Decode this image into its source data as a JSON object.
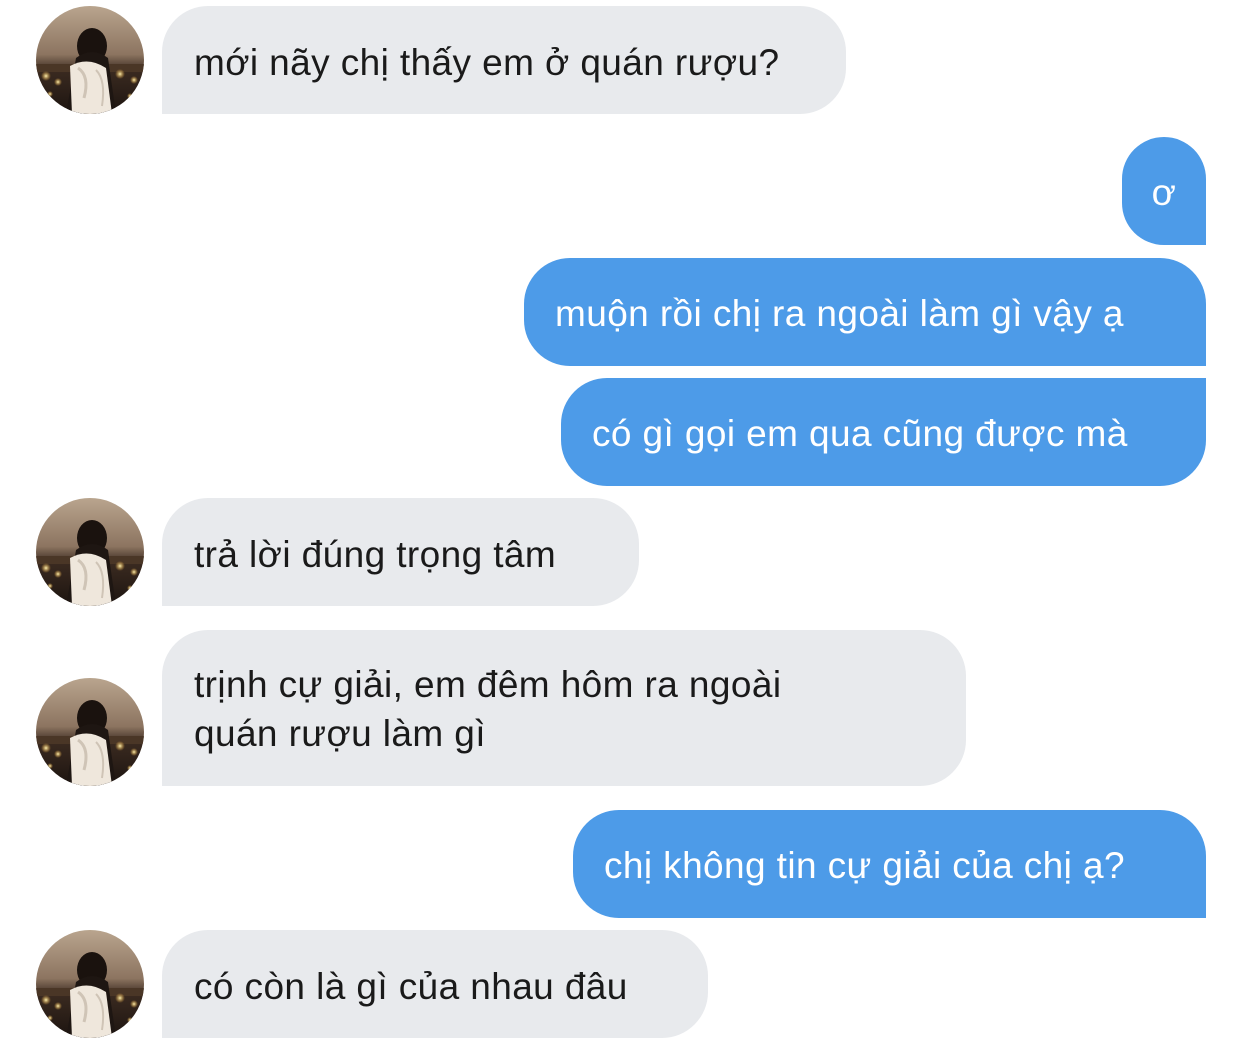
{
  "conversation": {
    "messages": [
      {
        "sender": "them",
        "text": "mới nãy chị thấy em ở quán rượu?"
      },
      {
        "sender": "me",
        "text": "ơ"
      },
      {
        "sender": "me",
        "text": "muộn rồi chị ra ngoài làm gì vậy ạ"
      },
      {
        "sender": "me",
        "text": "có gì gọi em qua cũng được mà"
      },
      {
        "sender": "them",
        "text": "trả lời đúng trọng tâm"
      },
      {
        "sender": "them",
        "lines": [
          "trịnh cự giải, em đêm hôm ra ngoài",
          "quán rượu làm gì"
        ]
      },
      {
        "sender": "me",
        "text": "chị không tin cự giải của chị ạ?"
      },
      {
        "sender": "them",
        "text": "có còn là gì của nhau đâu"
      }
    ]
  },
  "colors": {
    "incoming_bubble": "#e8eaed",
    "outgoing_bubble": "#4d9be8",
    "incoming_text": "#1a1a1a",
    "outgoing_text": "#ffffff"
  },
  "icons": {
    "contact_avatar": "avatar"
  }
}
